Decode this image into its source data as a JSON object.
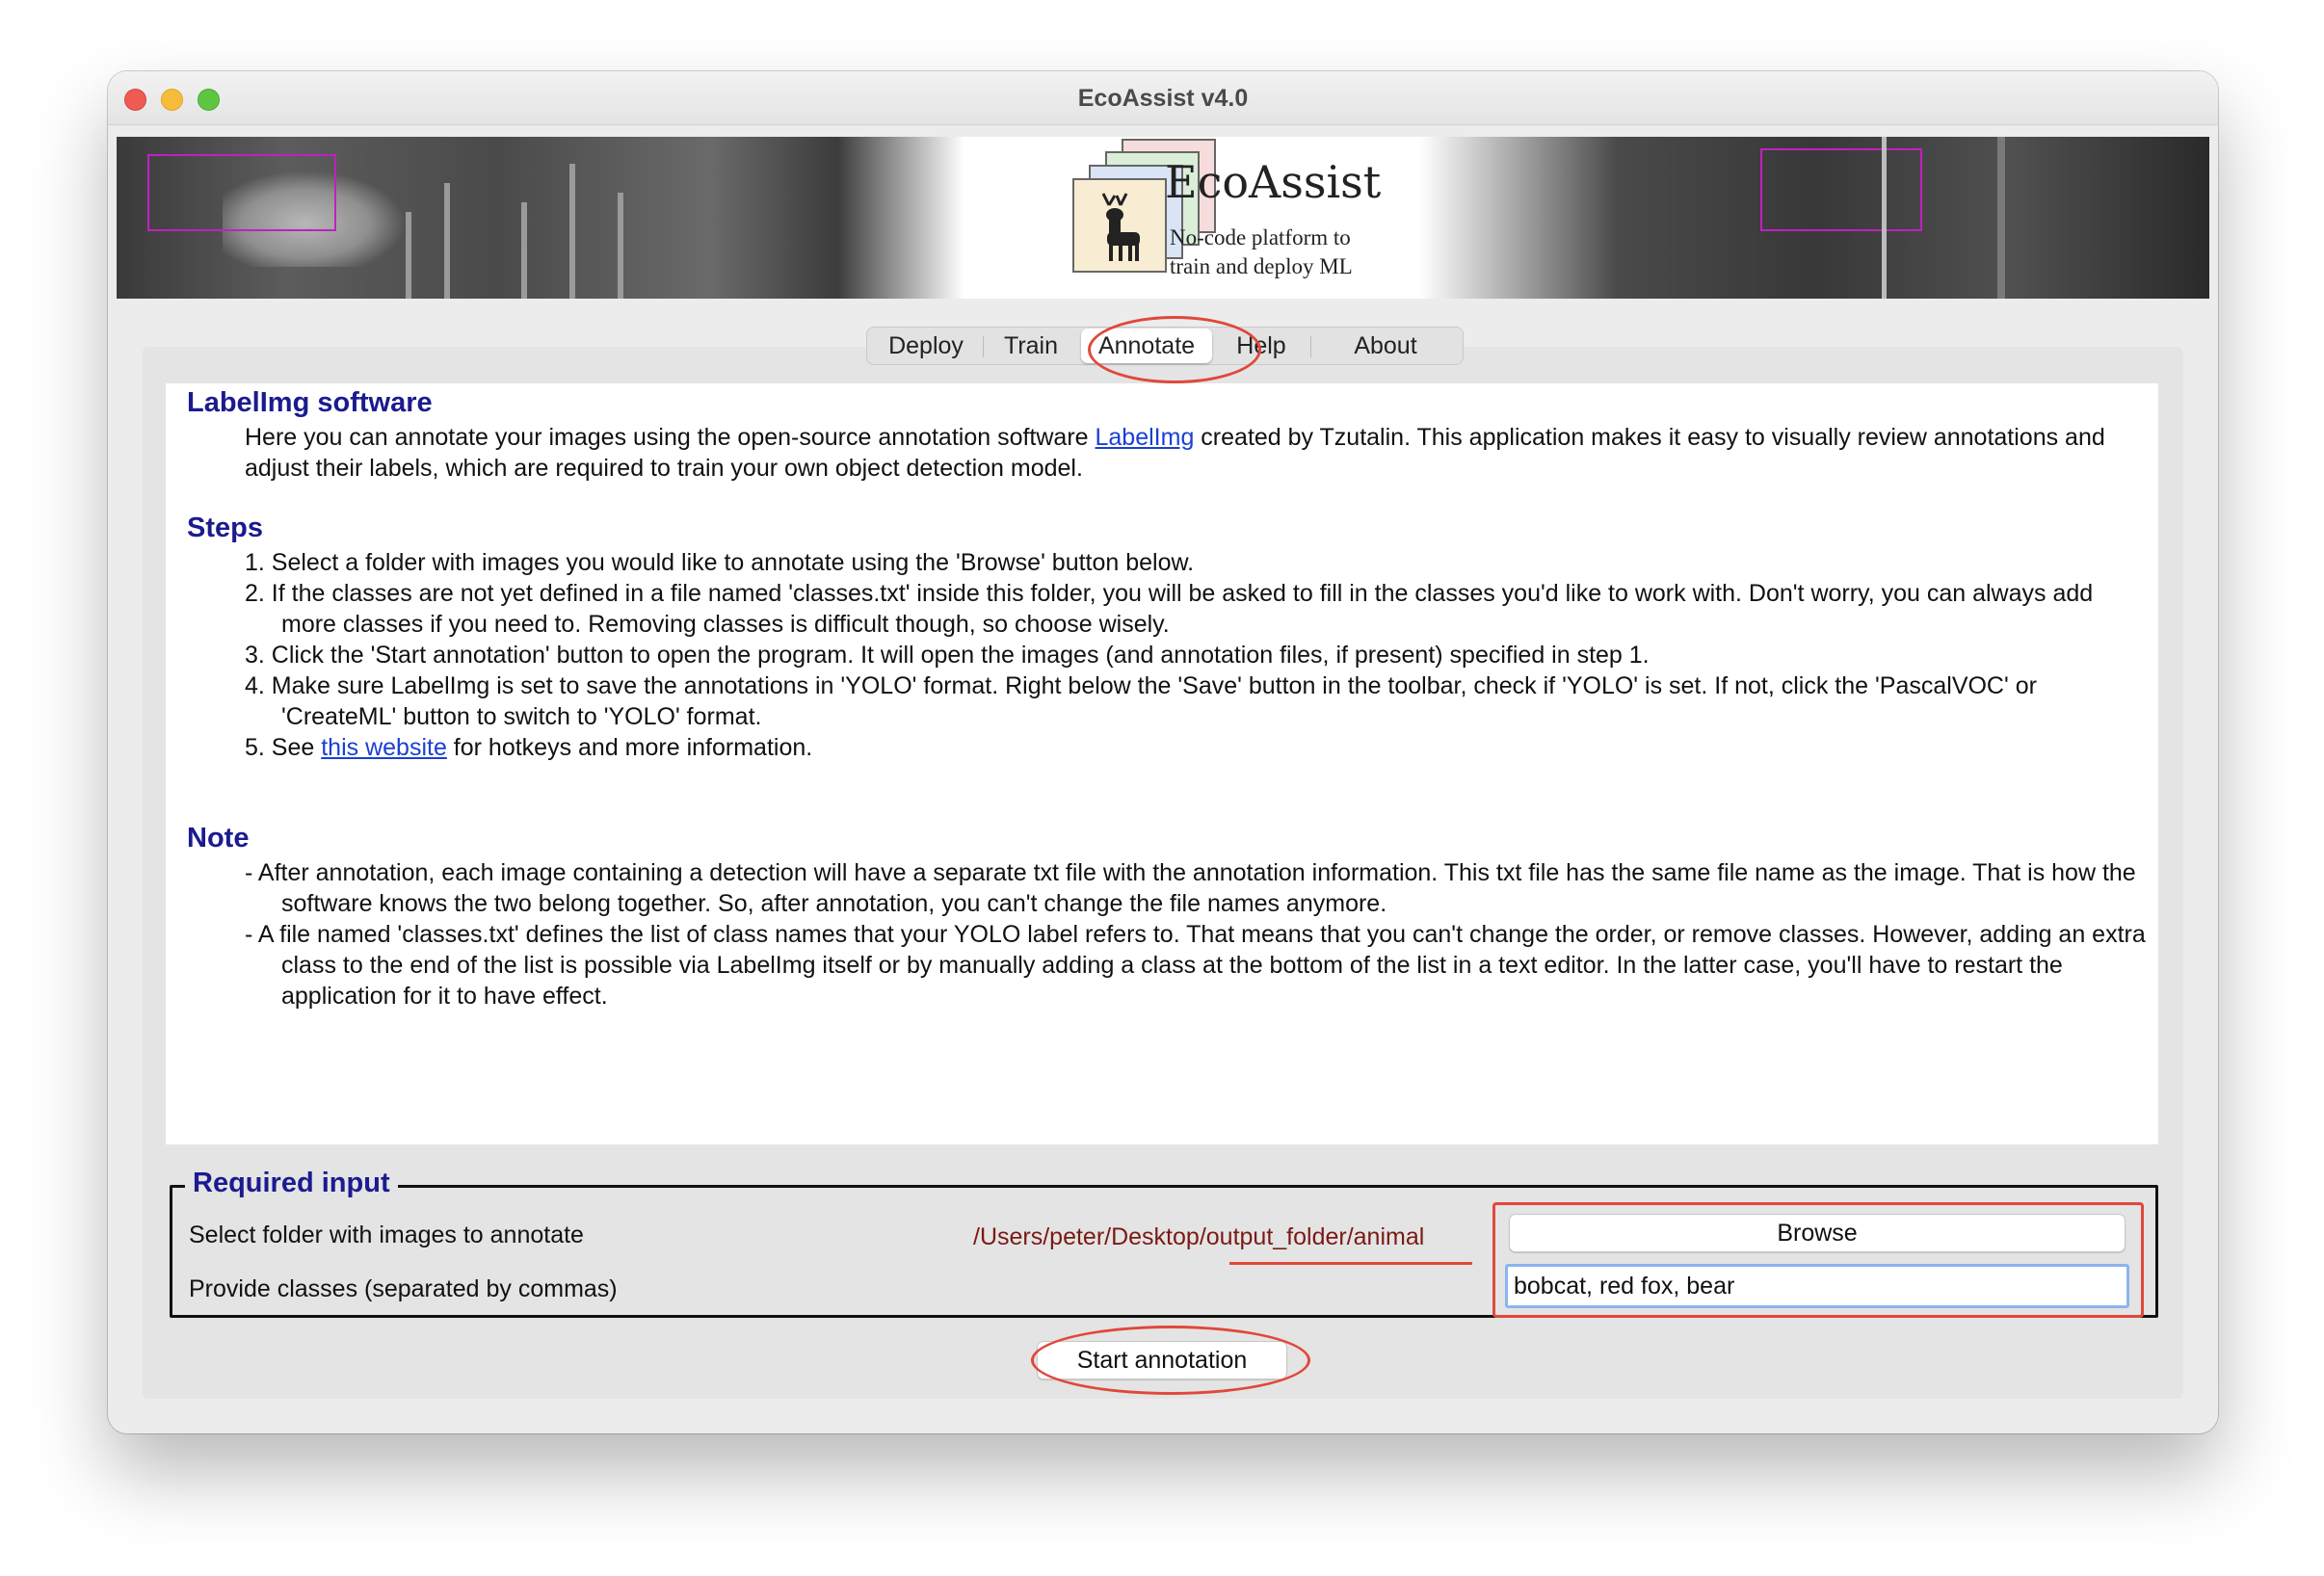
{
  "window": {
    "title": "EcoAssist v4.0"
  },
  "banner": {
    "logo_title": "EcoAssist",
    "logo_subtitle_line1": "No-code platform to",
    "logo_subtitle_line2": "train and deploy ML"
  },
  "tabs": [
    {
      "label": "Deploy",
      "active": false
    },
    {
      "label": "Train",
      "active": false
    },
    {
      "label": "Annotate",
      "active": true
    },
    {
      "label": "Help",
      "active": false
    },
    {
      "label": "About",
      "active": false
    }
  ],
  "help": {
    "labelimg_heading": "LabelImg software",
    "intro_pre": "Here you can annotate your images using the open-source annotation software ",
    "intro_link": "LabelImg",
    "intro_post": " created by Tzutalin. This application makes it easy to visually review annotations and adjust their labels, which are required to train your own object detection model.",
    "steps_heading": "Steps",
    "step1": "1. Select a folder with images you would like to annotate using the 'Browse' button below.",
    "step2": "2. If the classes are not yet defined in a file named 'classes.txt' inside this folder, you will be asked to fill in the classes you'd like to work with. Don't worry, you can always add more classes if you need to. Removing classes is difficult though, so choose wisely.",
    "step3": "3. Click the 'Start annotation' button to open the program. It will open the images (and annotation files, if present) specified in step 1.",
    "step4": "4. Make sure LabelImg is set to save the annotations in 'YOLO' format. Right below the 'Save' button in the toolbar, check if 'YOLO' is set. If not, click the 'PascalVOC' or 'CreateML' button to switch to 'YOLO' format.",
    "step5_pre": "5. See ",
    "step5_link": "this website",
    "step5_post": " for hotkeys and more information.",
    "note_heading": "Note",
    "note1": "- After annotation, each image containing a detection will have a separate txt file with the annotation information. This txt file has the same file name as the image. That is how the software knows the two belong together. So, after annotation, you can't change the file names anymore.",
    "note2": "- A file named 'classes.txt' defines the list of class names that your YOLO label refers to. That means that you can't change the order, or remove classes. However, adding an extra class to the end of the list is possible via LabelImg itself or by manually adding a class at the bottom of the list in a text editor. In the latter case, you'll have to restart the application for it to have effect."
  },
  "required_input": {
    "title": "Required input",
    "folder_label": "Select folder with images to annotate",
    "folder_path": "/Users/peter/Desktop/output_folder/animal",
    "browse_label": "Browse",
    "classes_label": "Provide classes (separated by commas)",
    "classes_value": "bobcat, red fox, bear"
  },
  "start_button": "Start annotation",
  "colors": {
    "heading": "#1b1b8f",
    "link": "#1a3fd4",
    "path": "#7a1a14",
    "annotation_red": "#e0483a"
  }
}
